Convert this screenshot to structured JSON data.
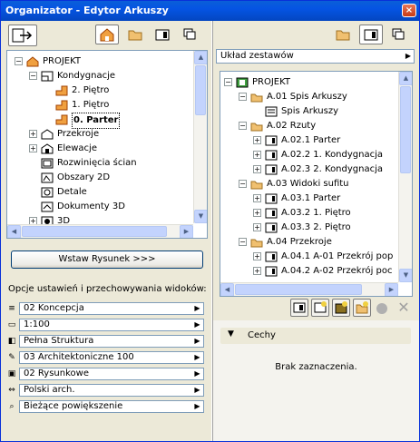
{
  "window": {
    "title": "Organizator - Edytor Arkuszy",
    "close": "×"
  },
  "left_tree": [
    {
      "label": "PROJEKT",
      "level": 0,
      "exp": "−",
      "icon": "house-icon"
    },
    {
      "label": "Kondygnacje",
      "level": 1,
      "exp": "−",
      "icon": "stories-icon"
    },
    {
      "label": "2. Piętro",
      "level": 2,
      "icon": "story-icon"
    },
    {
      "label": "1. Piętro",
      "level": 2,
      "icon": "story-icon"
    },
    {
      "label": "0. Parter",
      "level": 2,
      "icon": "story-icon",
      "bold": true
    },
    {
      "label": "Przekroje",
      "level": 1,
      "exp": "+",
      "icon": "section-icon"
    },
    {
      "label": "Elewacje",
      "level": 1,
      "exp": "+",
      "icon": "elevation-icon"
    },
    {
      "label": "Rozwinięcia ścian",
      "level": 1,
      "icon": "wall-icon"
    },
    {
      "label": "Obszary 2D",
      "level": 1,
      "icon": "area-icon"
    },
    {
      "label": "Detale",
      "level": 1,
      "icon": "detail-icon"
    },
    {
      "label": "Dokumenty 3D",
      "level": 1,
      "icon": "doc3d-icon"
    },
    {
      "label": "3D",
      "level": 1,
      "exp": "+",
      "icon": "3d-icon"
    }
  ],
  "place_button": "Wstaw Rysunek >>>",
  "options_title": "Opcje ustawień i przechowywania widoków:",
  "options": [
    {
      "icon": "layers-icon",
      "value": "02 Koncepcja"
    },
    {
      "icon": "scale-icon",
      "value": "1:100"
    },
    {
      "icon": "structure-icon",
      "value": "Pełna Struktura"
    },
    {
      "icon": "pen-icon",
      "value": "03 Architektoniczne 100"
    },
    {
      "icon": "model-icon",
      "value": "02 Rysunkowe"
    },
    {
      "icon": "dim-icon",
      "value": "Polski arch."
    },
    {
      "icon": "zoom-icon",
      "value": "Bieżące powiększenie"
    }
  ],
  "right_dropdown": "Układ zestawów",
  "right_tree": [
    {
      "label": "PROJEKT",
      "level": 0,
      "exp": "−"
    },
    {
      "label": "A.01 Spis Arkuszy",
      "level": 1,
      "exp": "−",
      "kind": "folder"
    },
    {
      "label": "Spis Arkuszy",
      "level": 2,
      "kind": "sheet"
    },
    {
      "label": "A.02 Rzuty",
      "level": 1,
      "exp": "−",
      "kind": "folder"
    },
    {
      "label": "A.02.1 Parter",
      "level": 2,
      "exp": "+",
      "kind": "layout"
    },
    {
      "label": "A.02.2 1. Kondygnacja",
      "level": 2,
      "exp": "+",
      "kind": "layout"
    },
    {
      "label": "A.02.3 2. Kondygnacja",
      "level": 2,
      "exp": "+",
      "kind": "layout"
    },
    {
      "label": "A.03 Widoki sufitu",
      "level": 1,
      "exp": "−",
      "kind": "folder"
    },
    {
      "label": "A.03.1 Parter",
      "level": 2,
      "exp": "+",
      "kind": "layout"
    },
    {
      "label": "A.03.2 1. Piętro",
      "level": 2,
      "exp": "+",
      "kind": "layout"
    },
    {
      "label": "A.03.3 2. Piętro",
      "level": 2,
      "exp": "+",
      "kind": "layout"
    },
    {
      "label": "A.04 Przekroje",
      "level": 1,
      "exp": "−",
      "kind": "folder"
    },
    {
      "label": "A.04.1 A-01 Przekrój pop",
      "level": 2,
      "exp": "+",
      "kind": "layout"
    },
    {
      "label": "A.04.2 A-02 Przekrój poc",
      "level": 2,
      "exp": "+",
      "kind": "layout"
    }
  ],
  "features": {
    "title": "Cechy",
    "empty": "Brak zaznaczenia."
  }
}
